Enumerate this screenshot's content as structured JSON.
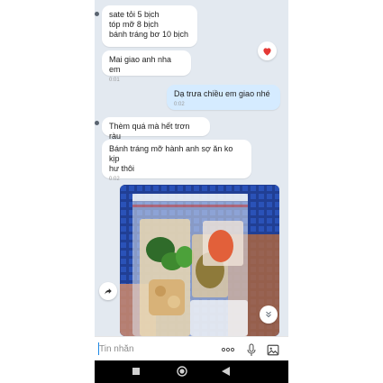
{
  "messages": [
    {
      "lines": [
        "sate tỏi 5 bịch",
        "tóp mỡ 8 bịch",
        "bánh tráng bơ 10 bịch"
      ],
      "time": ""
    },
    {
      "lines": [
        "Mai giao anh nha em"
      ],
      "time": "0:01"
    },
    {
      "lines": [
        "Dạ trưa chiều em giao nhé"
      ],
      "time": "0:02"
    },
    {
      "lines": [
        "Thèm quá mà hết trơn ràu"
      ],
      "time": ""
    },
    {
      "lines": [
        "Bánh tráng mỡ hành anh sợ ăn ko kịp",
        "hư thôi"
      ],
      "time": "0:02"
    }
  ],
  "reaction": {
    "icon": "heart-icon",
    "color": "#e53935"
  },
  "photo": {
    "description_icon": "photo-icon"
  },
  "composer": {
    "placeholder": "Tin nhắn"
  },
  "icons": {
    "more": "more-dots-icon",
    "mic": "microphone-icon",
    "gallery": "image-icon",
    "share": "share-icon",
    "scroll": "double-chevron-down-icon"
  },
  "colors": {
    "accent": "#1e88e5",
    "outgoing_bubble": "#d5ebff",
    "background": "#e3e9f0"
  }
}
